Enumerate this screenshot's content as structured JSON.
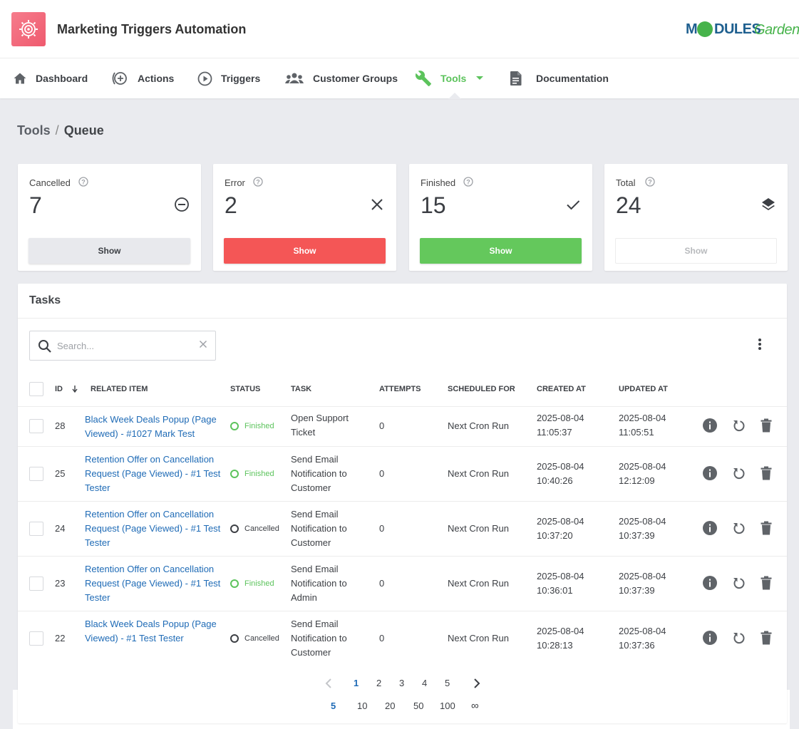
{
  "app": {
    "title": "Marketing Triggers Automation",
    "logo_icon": "target-gear-icon"
  },
  "brand": {
    "part1": "M",
    "part2": "DULES",
    "part3": "Garden",
    "colors": {
      "blue": "#1e5f8f",
      "green": "#47b34b"
    }
  },
  "nav": {
    "items": [
      {
        "label": "Dashboard",
        "icon": "home-icon"
      },
      {
        "label": "Actions",
        "icon": "add-circle-icon"
      },
      {
        "label": "Triggers",
        "icon": "play-circle-icon"
      },
      {
        "label": "Customer Groups",
        "icon": "group-icon"
      },
      {
        "label": "Tools",
        "icon": "wrench-icon",
        "active": true
      },
      {
        "label": "Documentation",
        "icon": "document-icon"
      }
    ],
    "active_color": "#5cc35c"
  },
  "breadcrumb": {
    "parent": "Tools",
    "separator": "/",
    "current": "Queue"
  },
  "stats": [
    {
      "title": "Cancelled",
      "value": "7",
      "icon": "minus-circle-icon",
      "button": "Show"
    },
    {
      "title": "Error",
      "value": "2",
      "icon": "close-icon",
      "button": "Show"
    },
    {
      "title": "Finished",
      "value": "15",
      "icon": "check-icon",
      "button": "Show"
    },
    {
      "title": "Total",
      "value": "24",
      "icon": "layers-icon",
      "button": "Show"
    }
  ],
  "tasks": {
    "title": "Tasks",
    "search": {
      "placeholder": "Search...",
      "value": ""
    },
    "columns": [
      "ID",
      "Related Item",
      "Status",
      "Task",
      "Attempts",
      "Scheduled For",
      "Created At",
      "Updated At"
    ],
    "sort": {
      "column": "ID",
      "direction": "desc"
    },
    "rows": [
      {
        "id": "28",
        "related": [
          "Black Week Deals Popup (Page",
          "Viewed) - #1027 Mark Test"
        ],
        "status": "Finished",
        "task": [
          "Open Support",
          "Ticket"
        ],
        "attempts": "0",
        "scheduled": "Next Cron Run",
        "created": [
          "2025-08-04",
          "11:05:37"
        ],
        "updated": [
          "2025-08-04",
          "11:05:51"
        ]
      },
      {
        "id": "25",
        "related": [
          "Retention Offer on Cancellation",
          "Request (Page Viewed) - #1 Test",
          "Tester"
        ],
        "status": "Finished",
        "task": [
          "Send Email",
          "Notification to",
          "Customer"
        ],
        "attempts": "0",
        "scheduled": "Next Cron Run",
        "created": [
          "2025-08-04",
          "10:40:26"
        ],
        "updated": [
          "2025-08-04",
          "12:12:09"
        ]
      },
      {
        "id": "24",
        "related": [
          "Retention Offer on Cancellation",
          "Request (Page Viewed) - #1 Test",
          "Tester"
        ],
        "status": "Cancelled",
        "task": [
          "Send Email",
          "Notification to",
          "Customer"
        ],
        "attempts": "0",
        "scheduled": "Next Cron Run",
        "created": [
          "2025-08-04",
          "10:37:20"
        ],
        "updated": [
          "2025-08-04",
          "10:37:39"
        ]
      },
      {
        "id": "23",
        "related": [
          "Retention Offer on Cancellation",
          "Request (Page Viewed) - #1 Test",
          "Tester"
        ],
        "status": "Finished",
        "task": [
          "Send Email",
          "Notification to",
          "Admin"
        ],
        "attempts": "0",
        "scheduled": "Next Cron Run",
        "created": [
          "2025-08-04",
          "10:36:01"
        ],
        "updated": [
          "2025-08-04",
          "10:37:39"
        ]
      },
      {
        "id": "22",
        "related": [
          "Black Week Deals Popup (Page",
          "Viewed) - #1 Test Tester"
        ],
        "status": "Cancelled",
        "task": [
          "Send Email",
          "Notification to",
          "Customer"
        ],
        "attempts": "0",
        "scheduled": "Next Cron Run",
        "created": [
          "2025-08-04",
          "10:28:13"
        ],
        "updated": [
          "2025-08-04",
          "10:37:36"
        ]
      }
    ],
    "row_actions": [
      "info-icon",
      "retry-icon",
      "trash-icon"
    ]
  },
  "pagination": {
    "pages": [
      "1",
      "2",
      "3",
      "4",
      "5"
    ],
    "current_page": "1",
    "page_sizes": [
      "5",
      "10",
      "20",
      "50",
      "100",
      "∞"
    ],
    "current_size": "5"
  },
  "colors": {
    "red": "#f45656",
    "green": "#64c85c",
    "link": "#1f6bb6",
    "grey_button": "#e8e9ed"
  }
}
